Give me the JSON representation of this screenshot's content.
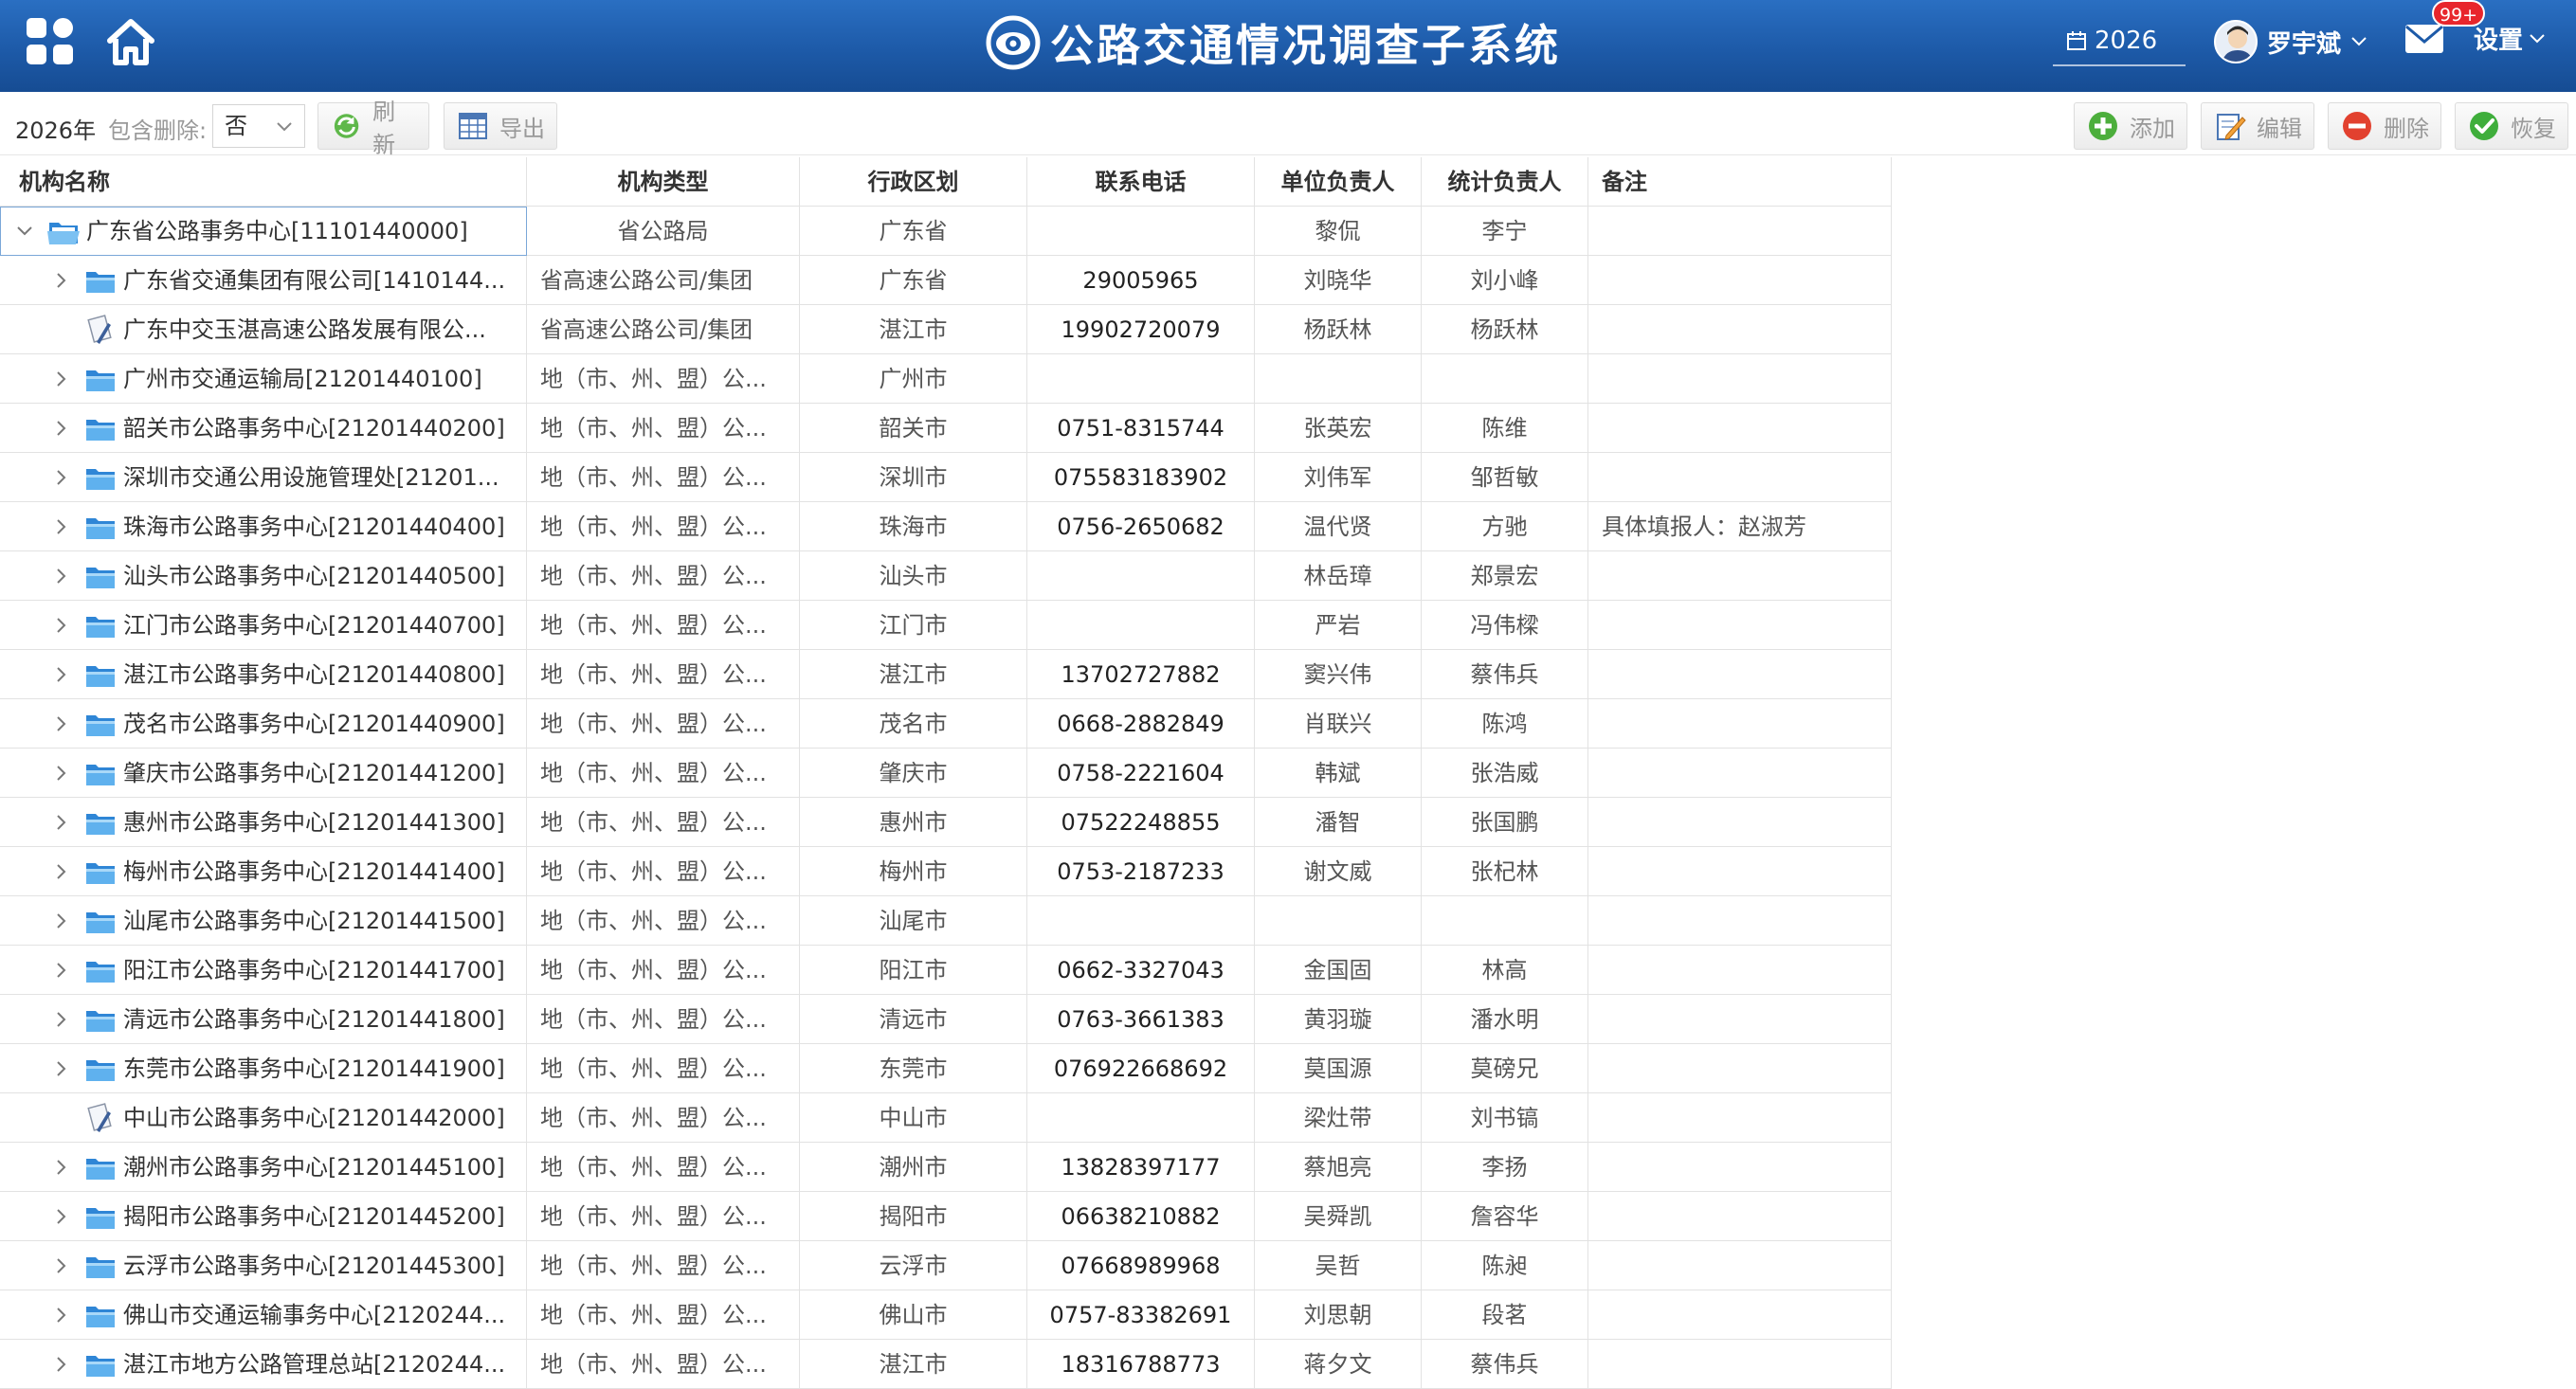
{
  "header": {
    "title": "公路交通情况调查子系统",
    "year": "2026",
    "user": "罗宇斌",
    "mail_badge": "99+",
    "settings": "设置"
  },
  "toolbar": {
    "year_label": "2026年",
    "include_deleted_label": "包含删除:",
    "include_deleted_value": "否",
    "refresh": "刷新",
    "export": "导出",
    "add": "添加",
    "edit": "编辑",
    "remove": "删除",
    "restore": "恢复"
  },
  "columns": [
    "机构名称",
    "机构类型",
    "行政区划",
    "联系电话",
    "单位负责人",
    "统计负责人",
    "备注"
  ],
  "rows": [
    {
      "name": "广东省公路事务中心[11101440000]",
      "type": "省公路局",
      "region": "广东省",
      "phone": "",
      "head": "黎侃",
      "stat": "李宁",
      "note": "",
      "level": 0,
      "expand": "open",
      "icon": "folder-open"
    },
    {
      "name": "广东省交通集团有限公司[1410144...",
      "type": "省高速公路公司/集团",
      "region": "广东省",
      "phone": "29005965",
      "head": "刘晓华",
      "stat": "刘小峰",
      "note": "",
      "level": 1,
      "expand": "closed",
      "icon": "folder"
    },
    {
      "name": "广东中交玉湛高速公路发展有限公...",
      "type": "省高速公路公司/集团",
      "region": "湛江市",
      "phone": "19902720079",
      "head": "杨跃林",
      "stat": "杨跃林",
      "note": "",
      "level": 1,
      "expand": "none",
      "icon": "doc"
    },
    {
      "name": "广州市交通运输局[21201440100]",
      "type": "地（市、州、盟）公...",
      "region": "广州市",
      "phone": "",
      "head": "",
      "stat": "",
      "note": "",
      "level": 1,
      "expand": "closed",
      "icon": "folder"
    },
    {
      "name": "韶关市公路事务中心[21201440200]",
      "type": "地（市、州、盟）公...",
      "region": "韶关市",
      "phone": "0751-8315744",
      "head": "张英宏",
      "stat": "陈维",
      "note": "",
      "level": 1,
      "expand": "closed",
      "icon": "folder"
    },
    {
      "name": "深圳市交通公用设施管理处[21201...",
      "type": "地（市、州、盟）公...",
      "region": "深圳市",
      "phone": "075583183902",
      "head": "刘伟军",
      "stat": "邹哲敏",
      "note": "",
      "level": 1,
      "expand": "closed",
      "icon": "folder"
    },
    {
      "name": "珠海市公路事务中心[21201440400]",
      "type": "地（市、州、盟）公...",
      "region": "珠海市",
      "phone": "0756-2650682",
      "head": "温代贤",
      "stat": "方驰",
      "note": "具体填报人：赵淑芳",
      "level": 1,
      "expand": "closed",
      "icon": "folder"
    },
    {
      "name": "汕头市公路事务中心[21201440500]",
      "type": "地（市、州、盟）公...",
      "region": "汕头市",
      "phone": "",
      "head": "林岳璋",
      "stat": "郑景宏",
      "note": "",
      "level": 1,
      "expand": "closed",
      "icon": "folder"
    },
    {
      "name": "江门市公路事务中心[21201440700]",
      "type": "地（市、州、盟）公...",
      "region": "江门市",
      "phone": "",
      "head": "严岩",
      "stat": "冯伟樑",
      "note": "",
      "level": 1,
      "expand": "closed",
      "icon": "folder"
    },
    {
      "name": "湛江市公路事务中心[21201440800]",
      "type": "地（市、州、盟）公...",
      "region": "湛江市",
      "phone": "13702727882",
      "head": "窦兴伟",
      "stat": "蔡伟兵",
      "note": "",
      "level": 1,
      "expand": "closed",
      "icon": "folder"
    },
    {
      "name": "茂名市公路事务中心[21201440900]",
      "type": "地（市、州、盟）公...",
      "region": "茂名市",
      "phone": "0668-2882849",
      "head": "肖联兴",
      "stat": "陈鸿",
      "note": "",
      "level": 1,
      "expand": "closed",
      "icon": "folder"
    },
    {
      "name": "肇庆市公路事务中心[21201441200]",
      "type": "地（市、州、盟）公...",
      "region": "肇庆市",
      "phone": "0758-2221604",
      "head": "韩斌",
      "stat": "张浩威",
      "note": "",
      "level": 1,
      "expand": "closed",
      "icon": "folder"
    },
    {
      "name": "惠州市公路事务中心[21201441300]",
      "type": "地（市、州、盟）公...",
      "region": "惠州市",
      "phone": "07522248855",
      "head": "潘智",
      "stat": "张国鹏",
      "note": "",
      "level": 1,
      "expand": "closed",
      "icon": "folder"
    },
    {
      "name": "梅州市公路事务中心[21201441400]",
      "type": "地（市、州、盟）公...",
      "region": "梅州市",
      "phone": "0753-2187233",
      "head": "谢文威",
      "stat": "张杞林",
      "note": "",
      "level": 1,
      "expand": "closed",
      "icon": "folder"
    },
    {
      "name": "汕尾市公路事务中心[21201441500]",
      "type": "地（市、州、盟）公...",
      "region": "汕尾市",
      "phone": "",
      "head": "",
      "stat": "",
      "note": "",
      "level": 1,
      "expand": "closed",
      "icon": "folder"
    },
    {
      "name": "阳江市公路事务中心[21201441700]",
      "type": "地（市、州、盟）公...",
      "region": "阳江市",
      "phone": "0662-3327043",
      "head": "金国固",
      "stat": "林高",
      "note": "",
      "level": 1,
      "expand": "closed",
      "icon": "folder"
    },
    {
      "name": "清远市公路事务中心[21201441800]",
      "type": "地（市、州、盟）公...",
      "region": "清远市",
      "phone": "0763-3661383",
      "head": "黄羽璇",
      "stat": "潘水明",
      "note": "",
      "level": 1,
      "expand": "closed",
      "icon": "folder"
    },
    {
      "name": "东莞市公路事务中心[21201441900]",
      "type": "地（市、州、盟）公...",
      "region": "东莞市",
      "phone": "076922668692",
      "head": "莫国源",
      "stat": "莫磅兄",
      "note": "",
      "level": 1,
      "expand": "closed",
      "icon": "folder"
    },
    {
      "name": "中山市公路事务中心[21201442000]",
      "type": "地（市、州、盟）公...",
      "region": "中山市",
      "phone": "",
      "head": "梁灶带",
      "stat": "刘书镐",
      "note": "",
      "level": 1,
      "expand": "none",
      "icon": "doc"
    },
    {
      "name": "潮州市公路事务中心[21201445100]",
      "type": "地（市、州、盟）公...",
      "region": "潮州市",
      "phone": "13828397177",
      "head": "蔡旭亮",
      "stat": "李扬",
      "note": "",
      "level": 1,
      "expand": "closed",
      "icon": "folder"
    },
    {
      "name": "揭阳市公路事务中心[21201445200]",
      "type": "地（市、州、盟）公...",
      "region": "揭阳市",
      "phone": "06638210882",
      "head": "吴舜凯",
      "stat": "詹容华",
      "note": "",
      "level": 1,
      "expand": "closed",
      "icon": "folder"
    },
    {
      "name": "云浮市公路事务中心[21201445300]",
      "type": "地（市、州、盟）公...",
      "region": "云浮市",
      "phone": "07668989968",
      "head": "吴哲",
      "stat": "陈昶",
      "note": "",
      "level": 1,
      "expand": "closed",
      "icon": "folder"
    },
    {
      "name": "佛山市交通运输事务中心[2120244...",
      "type": "地（市、州、盟）公...",
      "region": "佛山市",
      "phone": "0757-83382691",
      "head": "刘思朝",
      "stat": "段茗",
      "note": "",
      "level": 1,
      "expand": "closed",
      "icon": "folder"
    },
    {
      "name": "湛江市地方公路管理总站[2120244...",
      "type": "地（市、州、盟）公...",
      "region": "湛江市",
      "phone": "18316788773",
      "head": "蒋夕文",
      "stat": "蔡伟兵",
      "note": "",
      "level": 1,
      "expand": "closed",
      "icon": "folder"
    }
  ],
  "colors": {
    "header_bg": "#1d5aa8",
    "grid_border": "#e2e2e2",
    "folder_blue": "#3f9be0",
    "badge_red": "#e8262c"
  }
}
